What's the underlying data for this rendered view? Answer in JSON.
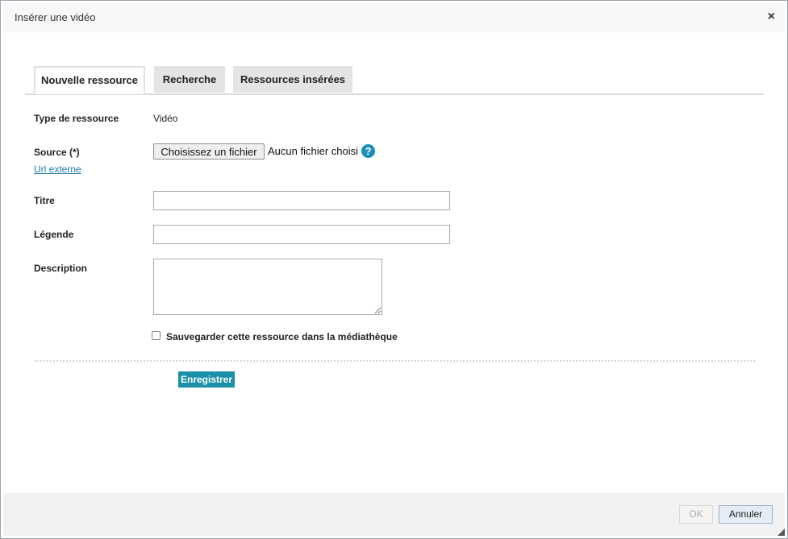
{
  "dialog": {
    "title": "Insérer une vidéo",
    "close_symbol": "×"
  },
  "tabs": [
    {
      "label": "Nouvelle ressource",
      "active": true
    },
    {
      "label": "Recherche",
      "active": false
    },
    {
      "label": "Ressources insérées",
      "active": false
    }
  ],
  "form": {
    "type_label": "Type de ressource",
    "type_value": "Vidéo",
    "source_label": "Source (*)",
    "file_button": "Choisissez un fichier",
    "file_status": "Aucun fichier choisi",
    "help_symbol": "?",
    "external_url_link": "Url externe",
    "title_label": "Titre",
    "title_value": "",
    "caption_label": "Légende",
    "caption_value": "",
    "description_label": "Description",
    "description_value": "",
    "save_to_library_label": "Sauvegarder cette ressource dans la médiathèque",
    "save_to_library_checked": false,
    "submit_label": "Enregistrer"
  },
  "footer": {
    "ok_label": "OK",
    "cancel_label": "Annuler"
  },
  "colors": {
    "accent": "#1a8fa8",
    "link": "#1a7aa8"
  }
}
